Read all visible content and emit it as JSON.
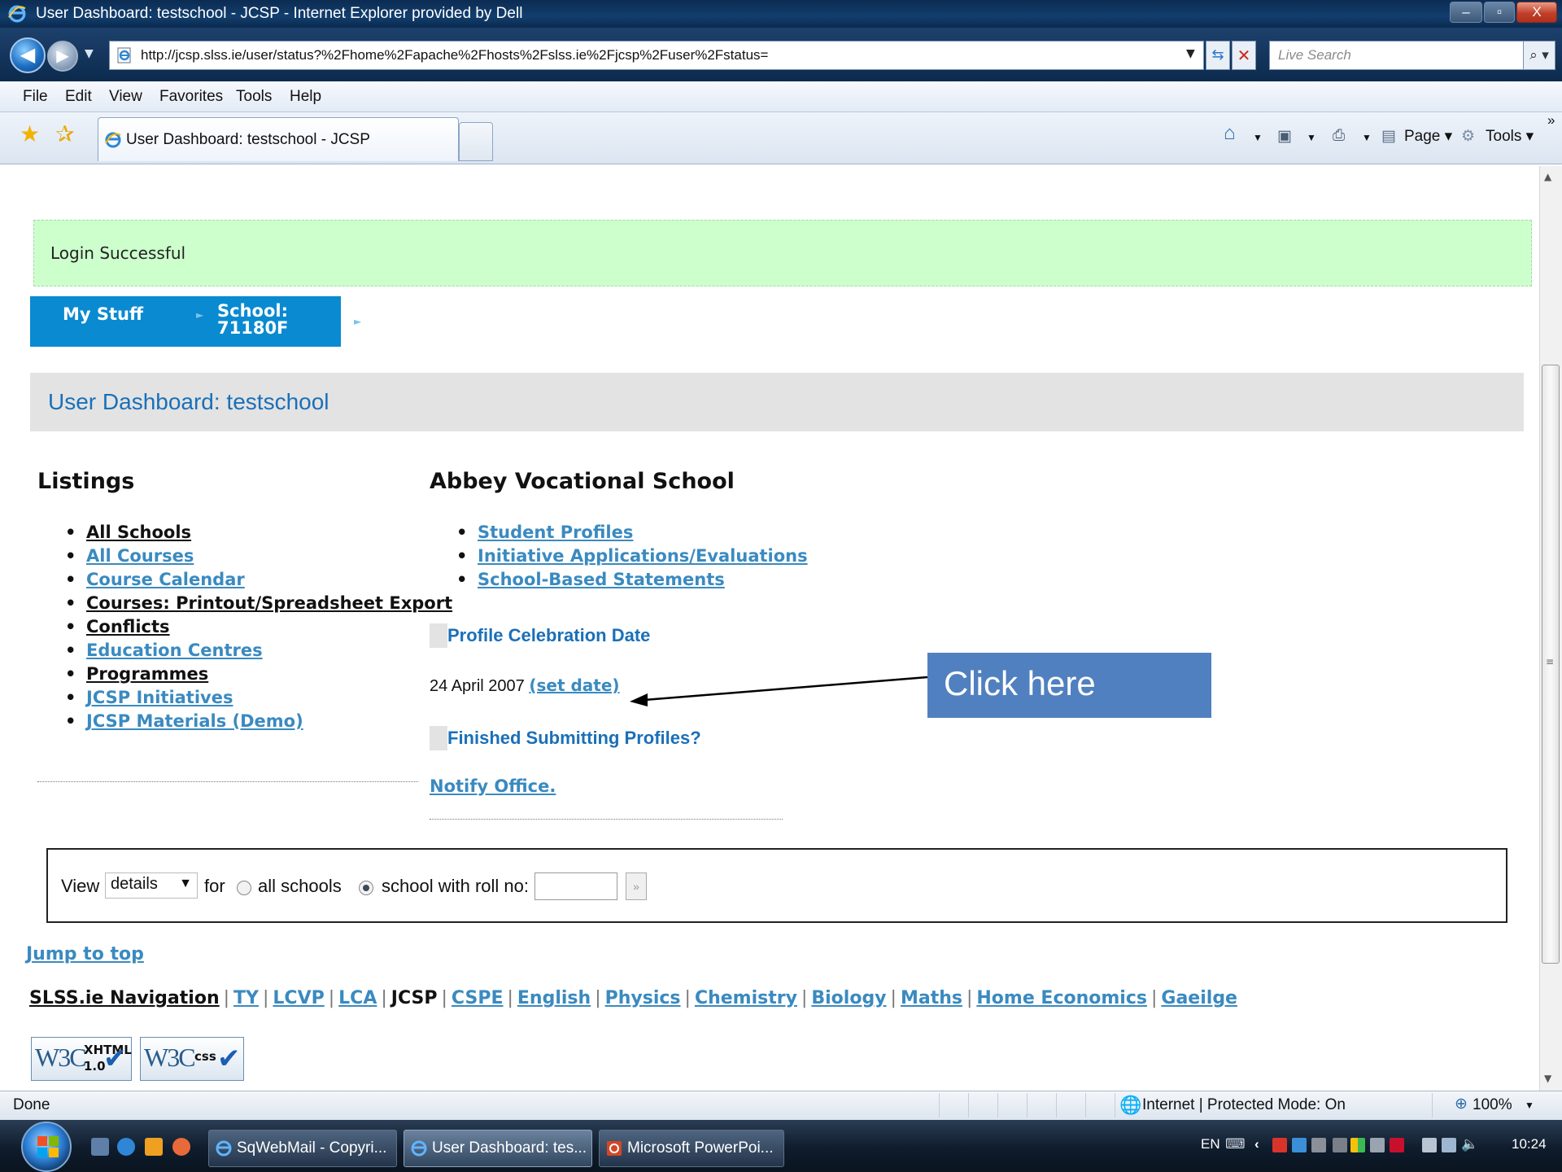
{
  "window": {
    "title": "User Dashboard: testschool - JCSP - Internet Explorer provided by Dell",
    "controls": {
      "minimize": "–",
      "maximize": "▫",
      "close": "X"
    }
  },
  "address_bar": {
    "url": "http://jcsp.slss.ie/user/status?%2Fhome%2Fapache%2Fhosts%2Fslss.ie%2Fjcsp%2Fuser%2Fstatus=",
    "search_placeholder": "Live Search"
  },
  "menu": [
    "File",
    "Edit",
    "View",
    "Favorites",
    "Tools",
    "Help"
  ],
  "tab": {
    "label": "User Dashboard: testschool - JCSP"
  },
  "command_bar": {
    "page": "Page",
    "tools": "Tools",
    "more": "»"
  },
  "page": {
    "login_message": "Login Successful",
    "breadcrumbs": {
      "my_stuff": "My Stuff",
      "school_line1": "School:",
      "school_line2": "71180F"
    },
    "dashboard_title": "User Dashboard: testschool",
    "listings": {
      "heading": "Listings",
      "items": [
        {
          "label": "All Schools",
          "style": "plain"
        },
        {
          "label": "All Courses",
          "style": "link"
        },
        {
          "label": "Course Calendar",
          "style": "link"
        },
        {
          "label": "Courses: Printout/Spreadsheet Export",
          "style": "plain"
        },
        {
          "label": "Conflicts",
          "style": "plain"
        },
        {
          "label": "Education Centres",
          "style": "link"
        },
        {
          "label": "Programmes",
          "style": "plain"
        },
        {
          "label": "JCSP Initiatives",
          "style": "link"
        },
        {
          "label": "JCSP Materials (Demo)",
          "style": "link"
        }
      ]
    },
    "school": {
      "heading": "Abbey Vocational School",
      "links": [
        "Student Profiles",
        "Initiative Applications/Evaluations",
        "School-Based Statements"
      ],
      "celebration_heading": "Profile Celebration Date",
      "celebration_date": "24 April 2007",
      "set_date_link": "(set date)",
      "finished_heading": "Finished Submitting Profiles?",
      "notify_link": "Notify Office."
    },
    "view_form": {
      "view_label": "View",
      "selected_view": "details",
      "for_label": "for",
      "option_all": "all schools",
      "option_roll": "school with roll no:",
      "selected_option": "school with roll no:",
      "roll_value": "",
      "go_glyph": "»"
    },
    "jump_to_top": "Jump to top",
    "footer_nav": {
      "label": "SLSS.ie Navigation",
      "items": [
        "TY",
        "LCVP",
        "LCA",
        "JCSP",
        "CSPE",
        "English",
        "Physics",
        "Chemistry",
        "Biology",
        "Maths",
        "Home Economics",
        "Gaeilge"
      ],
      "current": "JCSP"
    },
    "badges": [
      {
        "brand": "W3C",
        "line1": "XHTML",
        "line2": "1.0"
      },
      {
        "brand": "W3C",
        "line1": "css",
        "line2": ""
      }
    ]
  },
  "annotation": {
    "callout_text": "Click here"
  },
  "status_bar": {
    "text": "Done",
    "zone": "Internet | Protected Mode: On",
    "zoom": "100%"
  },
  "taskbar": {
    "tasks": [
      {
        "label": "SqWebMail - Copyri..."
      },
      {
        "label": "User Dashboard: tes..."
      },
      {
        "label": "Microsoft PowerPoi..."
      }
    ],
    "tray": {
      "language": "EN",
      "clock": "10:24"
    }
  },
  "colors": {
    "link_blue": "#3a8ac0",
    "heading_blue": "#1a70b8",
    "success_green": "#ccffcc",
    "breadcrumb_blue": "#0a8ad0",
    "callout_blue": "#5080bf"
  }
}
